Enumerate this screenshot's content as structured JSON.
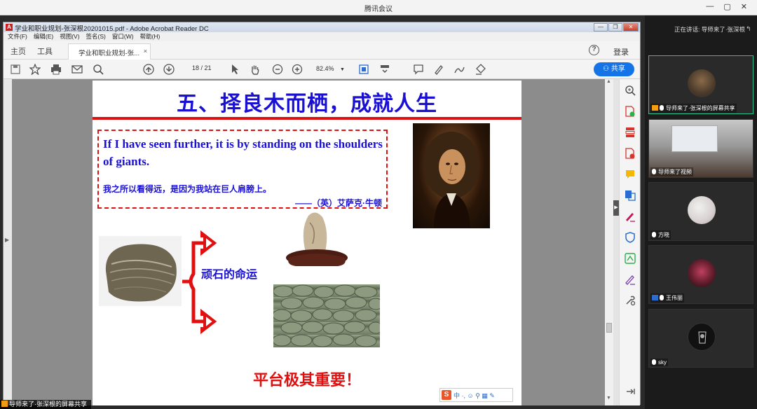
{
  "meeting": {
    "title": "腾讯会议",
    "speaking": "正在讲话: 导师来了·张深根"
  },
  "window": {
    "minimize": "—",
    "maximize": "▢",
    "close": "✕"
  },
  "reader": {
    "title": "学业和职业规划-张深根20201015.pdf - Adobe Acrobat Reader DC",
    "menu": [
      "文件(F)",
      "编辑(E)",
      "视图(V)",
      "签名(S)",
      "窗口(W)",
      "帮助(H)"
    ],
    "tabs": {
      "home": "主页",
      "tools": "工具",
      "doc": "学业和职业规划-张...",
      "close": "×"
    },
    "help": "?",
    "login": "登录",
    "toolbar": {
      "page_current": "18",
      "page_total": "/ 21",
      "zoom": "82.4%",
      "share": "共享"
    }
  },
  "slide": {
    "title": "五、择良木而栖，成就人生",
    "quote_en": "If I have seen further, it is by standing on the shoulders of giants.",
    "quote_zh": "我之所以看得远，是因为我站在巨人肩膀上。",
    "quote_author": "——（英）艾萨克·牛顿",
    "fate_label": "顽石的命运",
    "slogan": "平台极其重要！"
  },
  "ime": {
    "logo": "S",
    "text": "中 ·, ☺ ⚲ ▦ ✎"
  },
  "share_tag": "导师来了·张深根的屏幕共享",
  "participants": [
    {
      "name": "导师来了·张深根的屏幕共享"
    },
    {
      "name": "导师来了视频"
    },
    {
      "name": "方晓"
    },
    {
      "name": "王伟丽"
    },
    {
      "name": "sky"
    }
  ]
}
